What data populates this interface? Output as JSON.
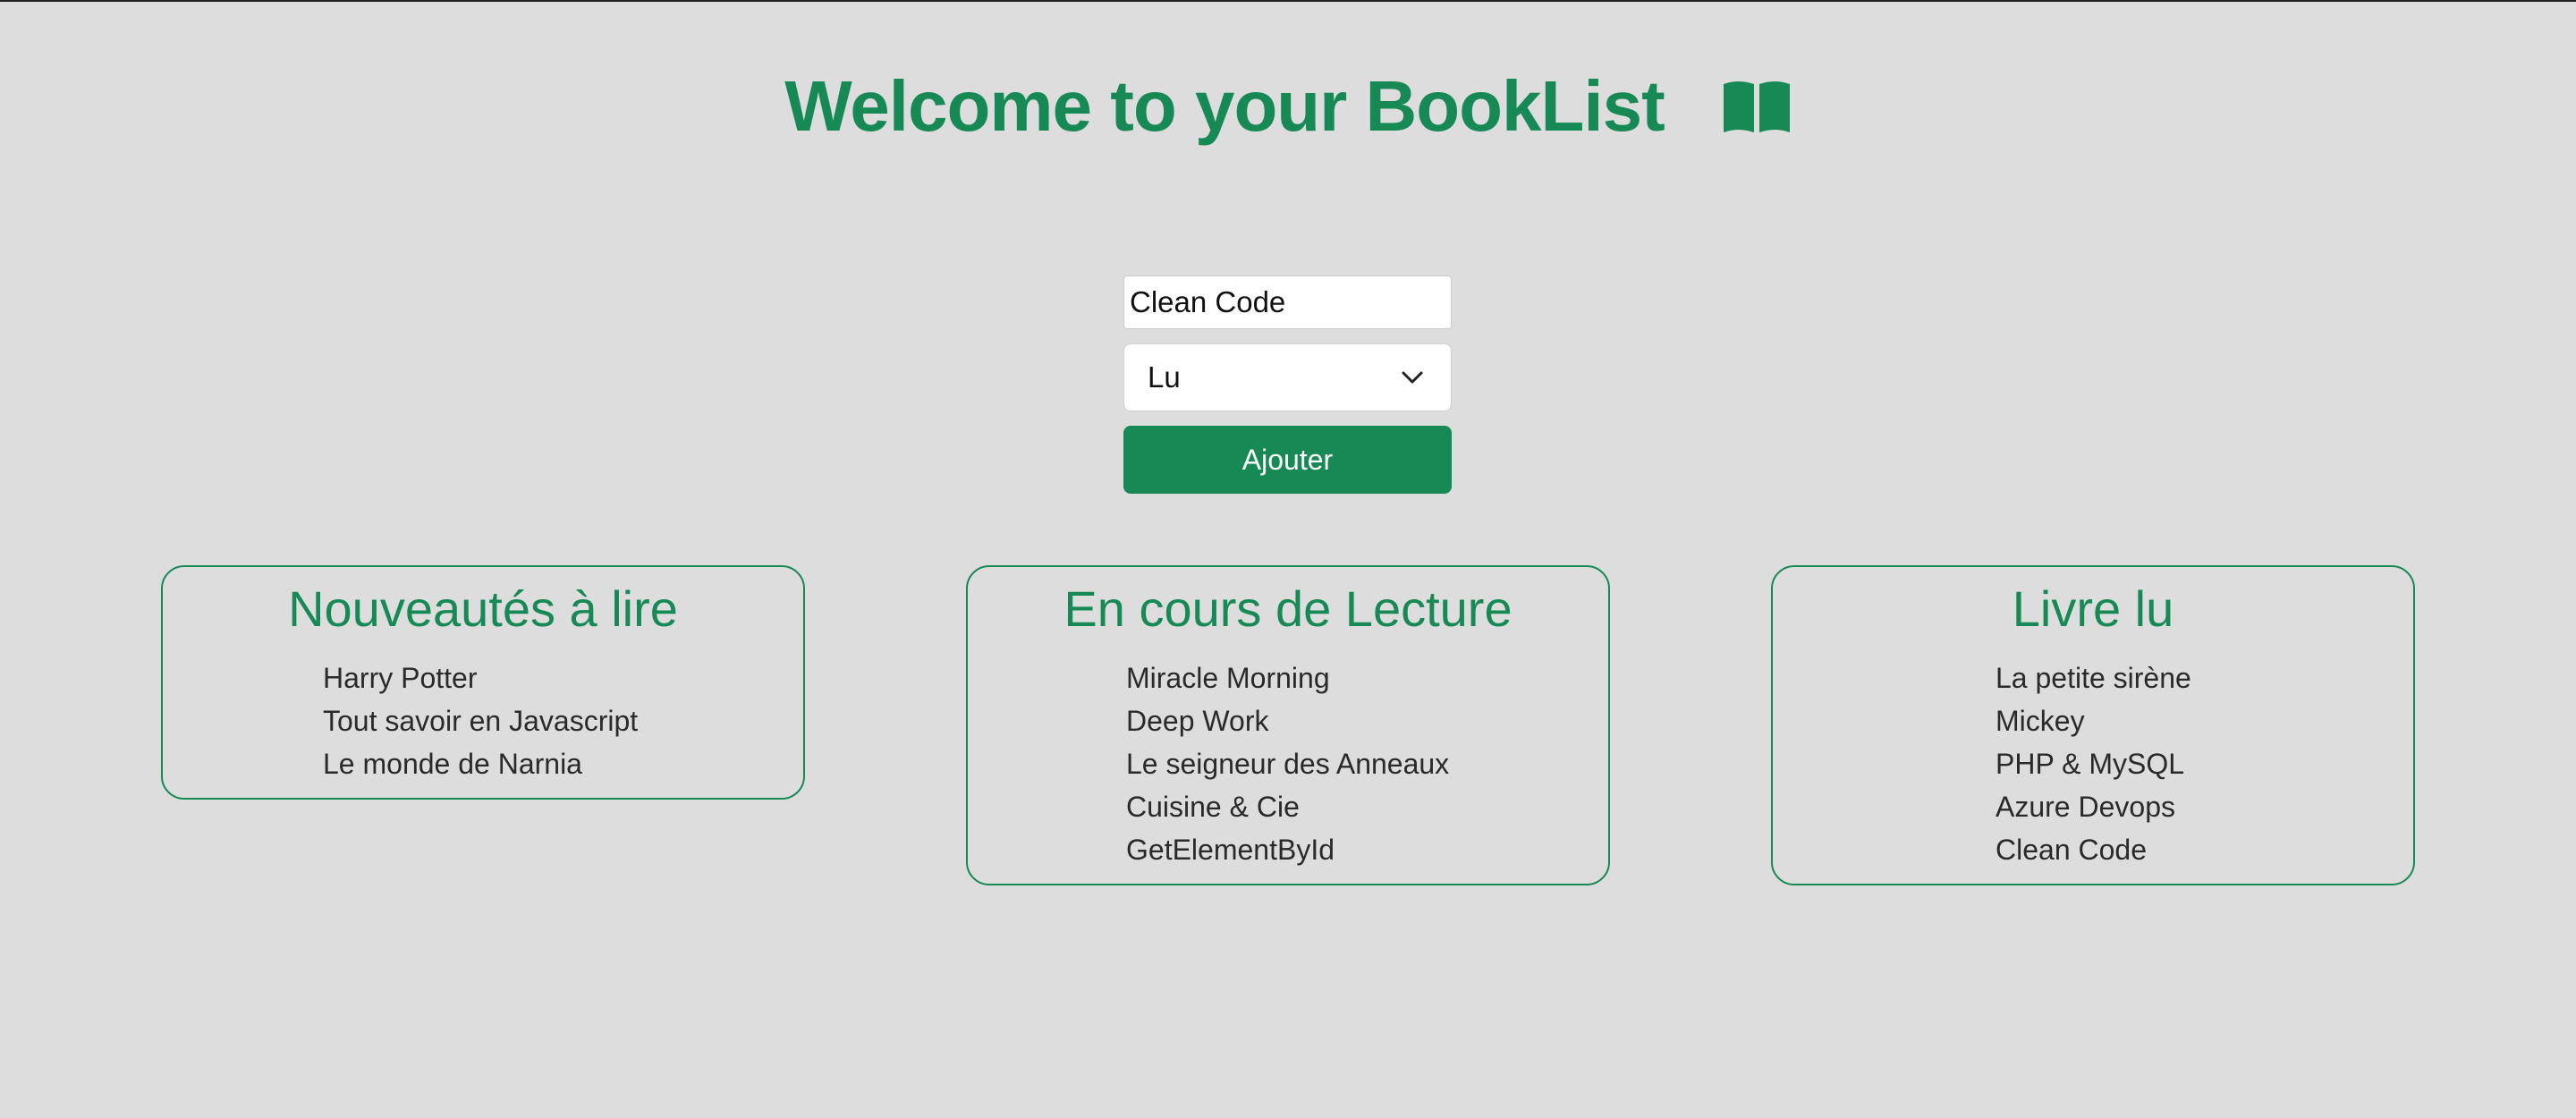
{
  "header": {
    "title": "Welcome to your BookList",
    "icon": "open-book-icon",
    "accent_color": "#168954"
  },
  "form": {
    "title_input_value": "Clean Code",
    "status_select_value": "Lu",
    "add_button_label": "Ajouter"
  },
  "lists": {
    "new": {
      "title": "Nouveautés à lire",
      "items": [
        "Harry Potter",
        "Tout savoir en Javascript",
        "Le monde de Narnia"
      ]
    },
    "reading": {
      "title": "En cours de Lecture",
      "items": [
        "Miracle Morning",
        "Deep Work",
        "Le seigneur des Anneaux",
        "Cuisine & Cie",
        "GetElementById"
      ]
    },
    "read": {
      "title": "Livre lu",
      "items": [
        "La petite sirène",
        "Mickey",
        "PHP & MySQL",
        "Azure Devops",
        "Clean Code"
      ]
    }
  }
}
